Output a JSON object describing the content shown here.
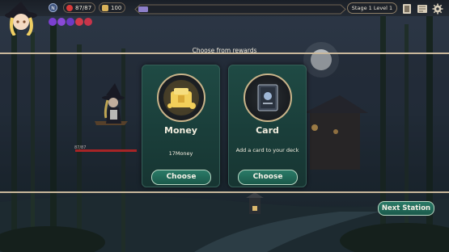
{
  "hud": {
    "level_badge": "N",
    "hp": "87/87",
    "gold": "100",
    "stage": "Stage 1 Level 1",
    "orb_colors": [
      "#7b3fd0",
      "#8a49d6",
      "#6c3ac4",
      "#d23a4a",
      "#c8344a"
    ],
    "icons": [
      "deck-icon",
      "map-icon",
      "settings-gear-icon"
    ]
  },
  "rewards": {
    "title": "Choose from rewards",
    "options": [
      {
        "title": "Money",
        "description": "17Money",
        "button": "Choose",
        "icon": "gold-coins-icon"
      },
      {
        "title": "Card",
        "description": "Add a card to your deck",
        "button": "Choose",
        "icon": "card-book-icon"
      }
    ]
  },
  "player": {
    "hp_text": "87/87",
    "hp_fraction": 1.0
  },
  "next_button": "Next Station"
}
